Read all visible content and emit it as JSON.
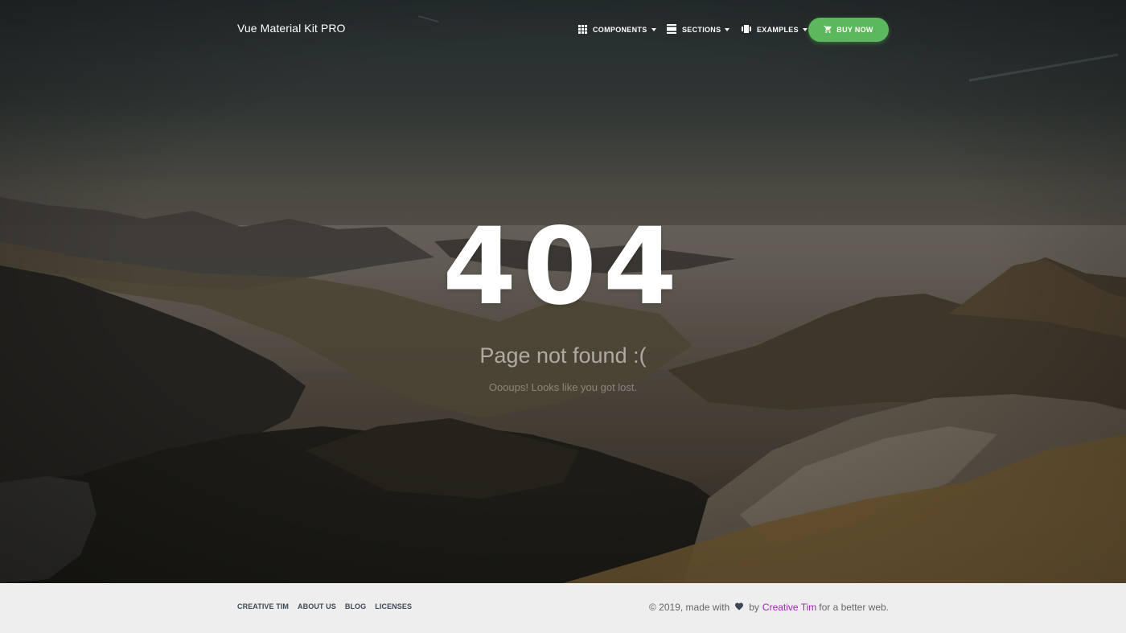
{
  "navbar": {
    "brand": "Vue Material Kit PRO",
    "items": [
      {
        "label": "COMPONENTS",
        "icon": "apps-grid-icon"
      },
      {
        "label": "SECTIONS",
        "icon": "view-day-icon"
      },
      {
        "label": "EXAMPLES",
        "icon": "view-carousel-icon"
      }
    ],
    "buy_label": "BUY NOW",
    "buy_icon": "shopping-cart-icon",
    "buy_color": "#5cb85c"
  },
  "hero": {
    "code": "404",
    "subtitle": "Page not found :(",
    "description": "Oooups! Looks like you got lost."
  },
  "footer": {
    "links": [
      "CREATIVE TIM",
      "ABOUT US",
      "BLOG",
      "LICENSES"
    ],
    "copyright_prefix": "© 2019, made with",
    "by": "by",
    "author": "Creative Tim",
    "suffix": "for a better web.",
    "heart_icon": "heart-icon",
    "author_color": "#9c27b0"
  }
}
